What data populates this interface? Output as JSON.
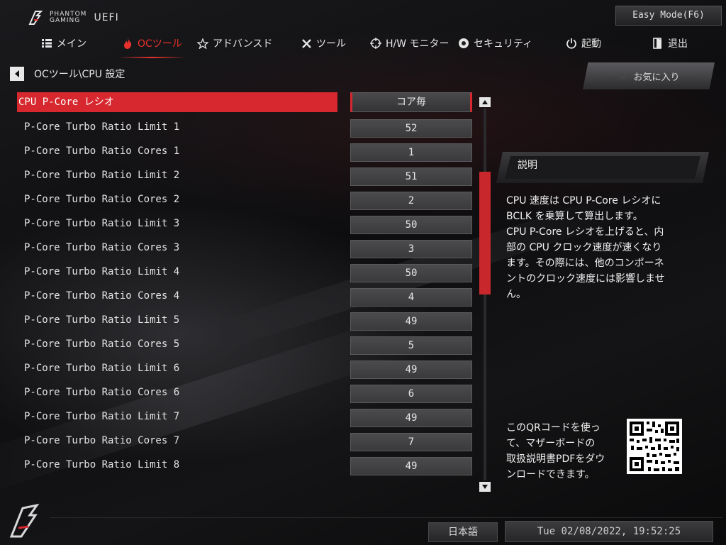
{
  "header": {
    "brand_line1": "PHANTOM",
    "brand_line2": "GAMING",
    "brand_uefi": "UEFI",
    "easy_mode_label": "Easy Mode(F6)"
  },
  "menu": [
    {
      "label": "メイン",
      "icon": "list-icon",
      "active": false
    },
    {
      "label": "OCツール",
      "icon": "flame-icon",
      "active": true
    },
    {
      "label": "アドバンスド",
      "icon": "star-icon",
      "active": false
    },
    {
      "label": "ツール",
      "icon": "tools-icon",
      "active": false
    },
    {
      "label": "H/W モニター",
      "icon": "crosshair-icon",
      "active": false
    },
    {
      "label": "セキュリティ",
      "icon": "shield-icon",
      "active": false
    },
    {
      "label": "起動",
      "icon": "power-icon",
      "active": false
    },
    {
      "label": "退出",
      "icon": "exit-icon",
      "active": false
    }
  ],
  "breadcrumb": "OCツール\\CPU 設定",
  "settings": [
    {
      "label": "CPU P-Core レシオ",
      "value": "コア毎",
      "selected": true
    },
    {
      "label": "P-Core Turbo Ratio Limit 1",
      "value": "52"
    },
    {
      "label": "P-Core Turbo Ratio Cores 1",
      "value": "1"
    },
    {
      "label": "P-Core Turbo Ratio Limit 2",
      "value": "51"
    },
    {
      "label": "P-Core Turbo Ratio Cores 2",
      "value": "2"
    },
    {
      "label": "P-Core Turbo Ratio Limit 3",
      "value": "50"
    },
    {
      "label": "P-Core Turbo Ratio Cores 3",
      "value": "3"
    },
    {
      "label": "P-Core Turbo Ratio Limit 4",
      "value": "50"
    },
    {
      "label": "P-Core Turbo Ratio Cores 4",
      "value": "4"
    },
    {
      "label": "P-Core Turbo Ratio Limit 5",
      "value": "49"
    },
    {
      "label": "P-Core Turbo Ratio Cores 5",
      "value": "5"
    },
    {
      "label": "P-Core Turbo Ratio Limit 6",
      "value": "49"
    },
    {
      "label": "P-Core Turbo Ratio Cores 6",
      "value": "6"
    },
    {
      "label": "P-Core Turbo Ratio Limit 7",
      "value": "49"
    },
    {
      "label": "P-Core Turbo Ratio Cores 7",
      "value": "7"
    },
    {
      "label": "P-Core Turbo Ratio Limit 8",
      "value": "49"
    }
  ],
  "scroll": {
    "thumb_start": 0.17,
    "thumb_end": 0.5
  },
  "favorites_label": "お気に入り",
  "description": {
    "title": "説明",
    "lines": [
      "CPU 速度は CPU P-Core レシオに",
      "BCLK を乗算して算出します。",
      "CPU P-Core レシオを上げると、内",
      "部の CPU クロック速度が速くなり",
      "ます。その際には、他のコンポーネ",
      "ントのクロック速度には影響しませ",
      "ん。"
    ]
  },
  "qr_text": [
    "このQRコードを使っ",
    "て、マザーボードの",
    "取扱説明書PDFをダウ",
    "ンロードできます。"
  ],
  "footer": {
    "language": "日本語",
    "datetime": "Tue 02/08/2022, 19:52:25"
  },
  "colors": {
    "accent": "#d6282e",
    "active_menu": "#e8312c"
  }
}
